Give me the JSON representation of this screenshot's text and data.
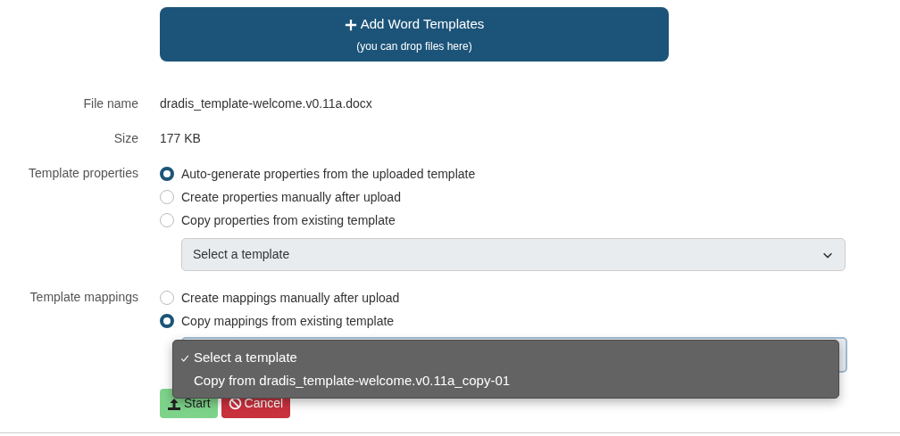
{
  "upload_button": {
    "label": "Add Word Templates",
    "hint": "(you can drop files here)"
  },
  "fields": [
    {
      "label": "File name",
      "value": "dradis_template-welcome.v0.11a.docx"
    },
    {
      "label": "Size",
      "value": "177 KB"
    }
  ],
  "template_properties": {
    "label": "Template properties",
    "options": [
      {
        "label": "Auto-generate properties from the uploaded template",
        "selected": true
      },
      {
        "label": "Create properties manually after upload",
        "selected": false
      },
      {
        "label": "Copy properties from existing template",
        "selected": false
      }
    ],
    "select": {
      "value": "Select a template"
    }
  },
  "template_mappings": {
    "label": "Template mappings",
    "options": [
      {
        "label": "Create mappings manually after upload",
        "selected": false
      },
      {
        "label": "Copy mappings from existing template",
        "selected": true
      }
    ],
    "dropdown": {
      "options": [
        {
          "label": "Select a template",
          "selected": true
        },
        {
          "label": "Copy from dradis_template-welcome.v0.11a_copy-01",
          "selected": false
        }
      ]
    }
  },
  "buttons": [
    {
      "kind": "start",
      "label": "Start"
    },
    {
      "kind": "cancel",
      "label": "Cancel"
    }
  ]
}
